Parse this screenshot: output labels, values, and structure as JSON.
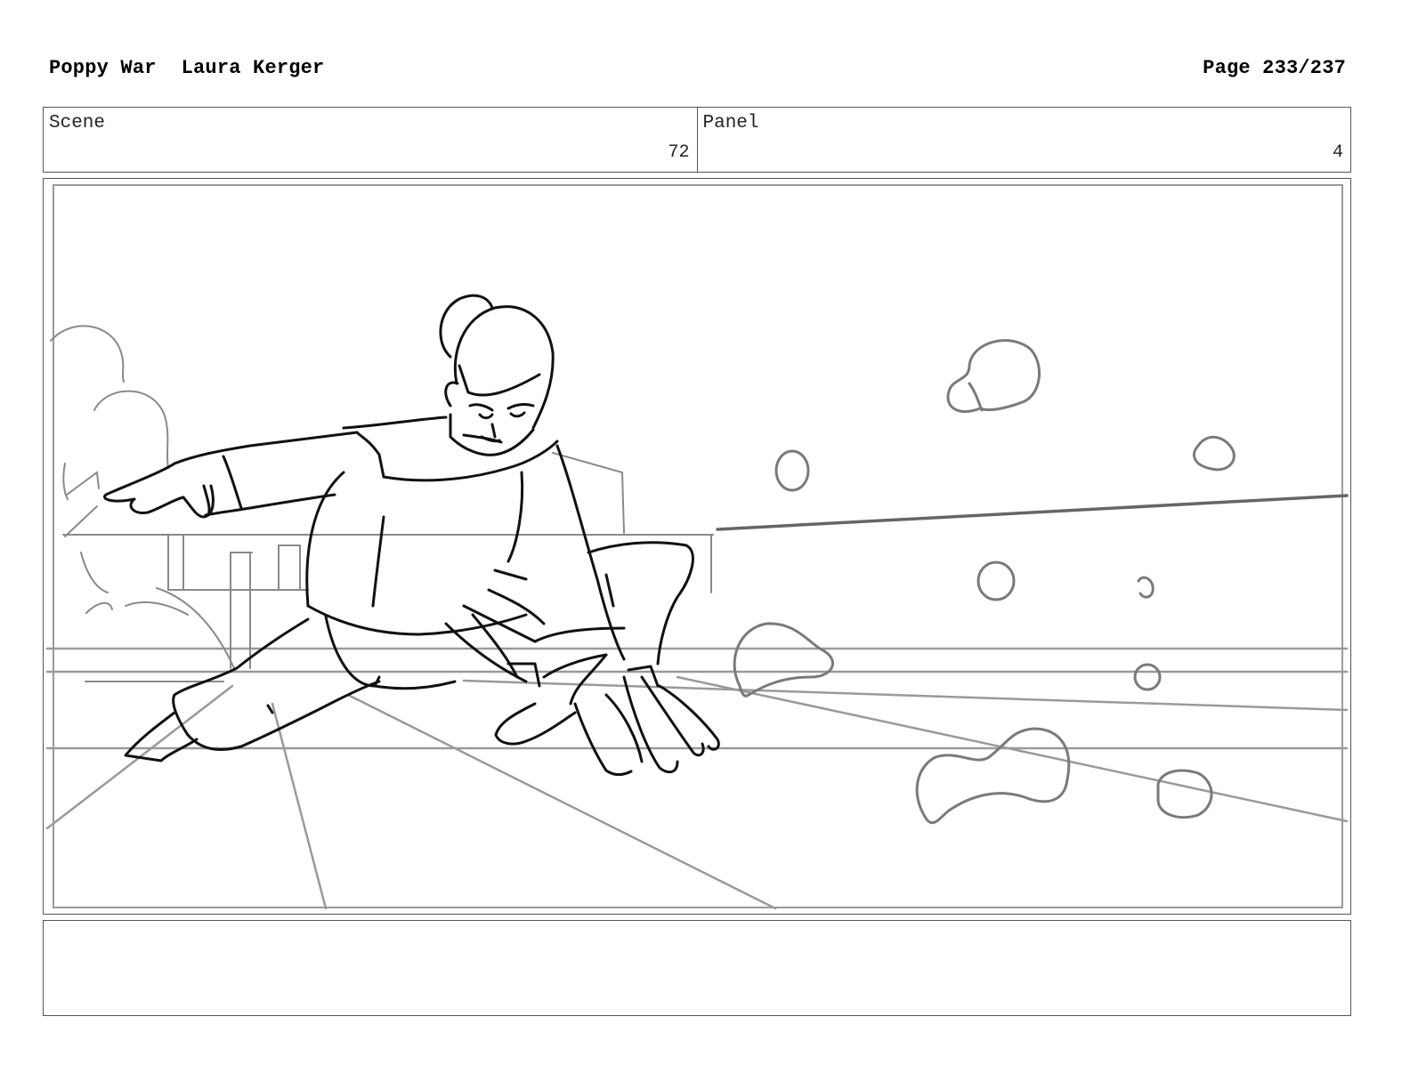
{
  "header": {
    "project": "Poppy War",
    "artist": "Laura Kerger",
    "page": "Page 233/237"
  },
  "info": {
    "scene_label": "Scene",
    "scene_value": "72",
    "panel_label": "Panel",
    "panel_value": "4"
  },
  "notes": {
    "text": ""
  }
}
